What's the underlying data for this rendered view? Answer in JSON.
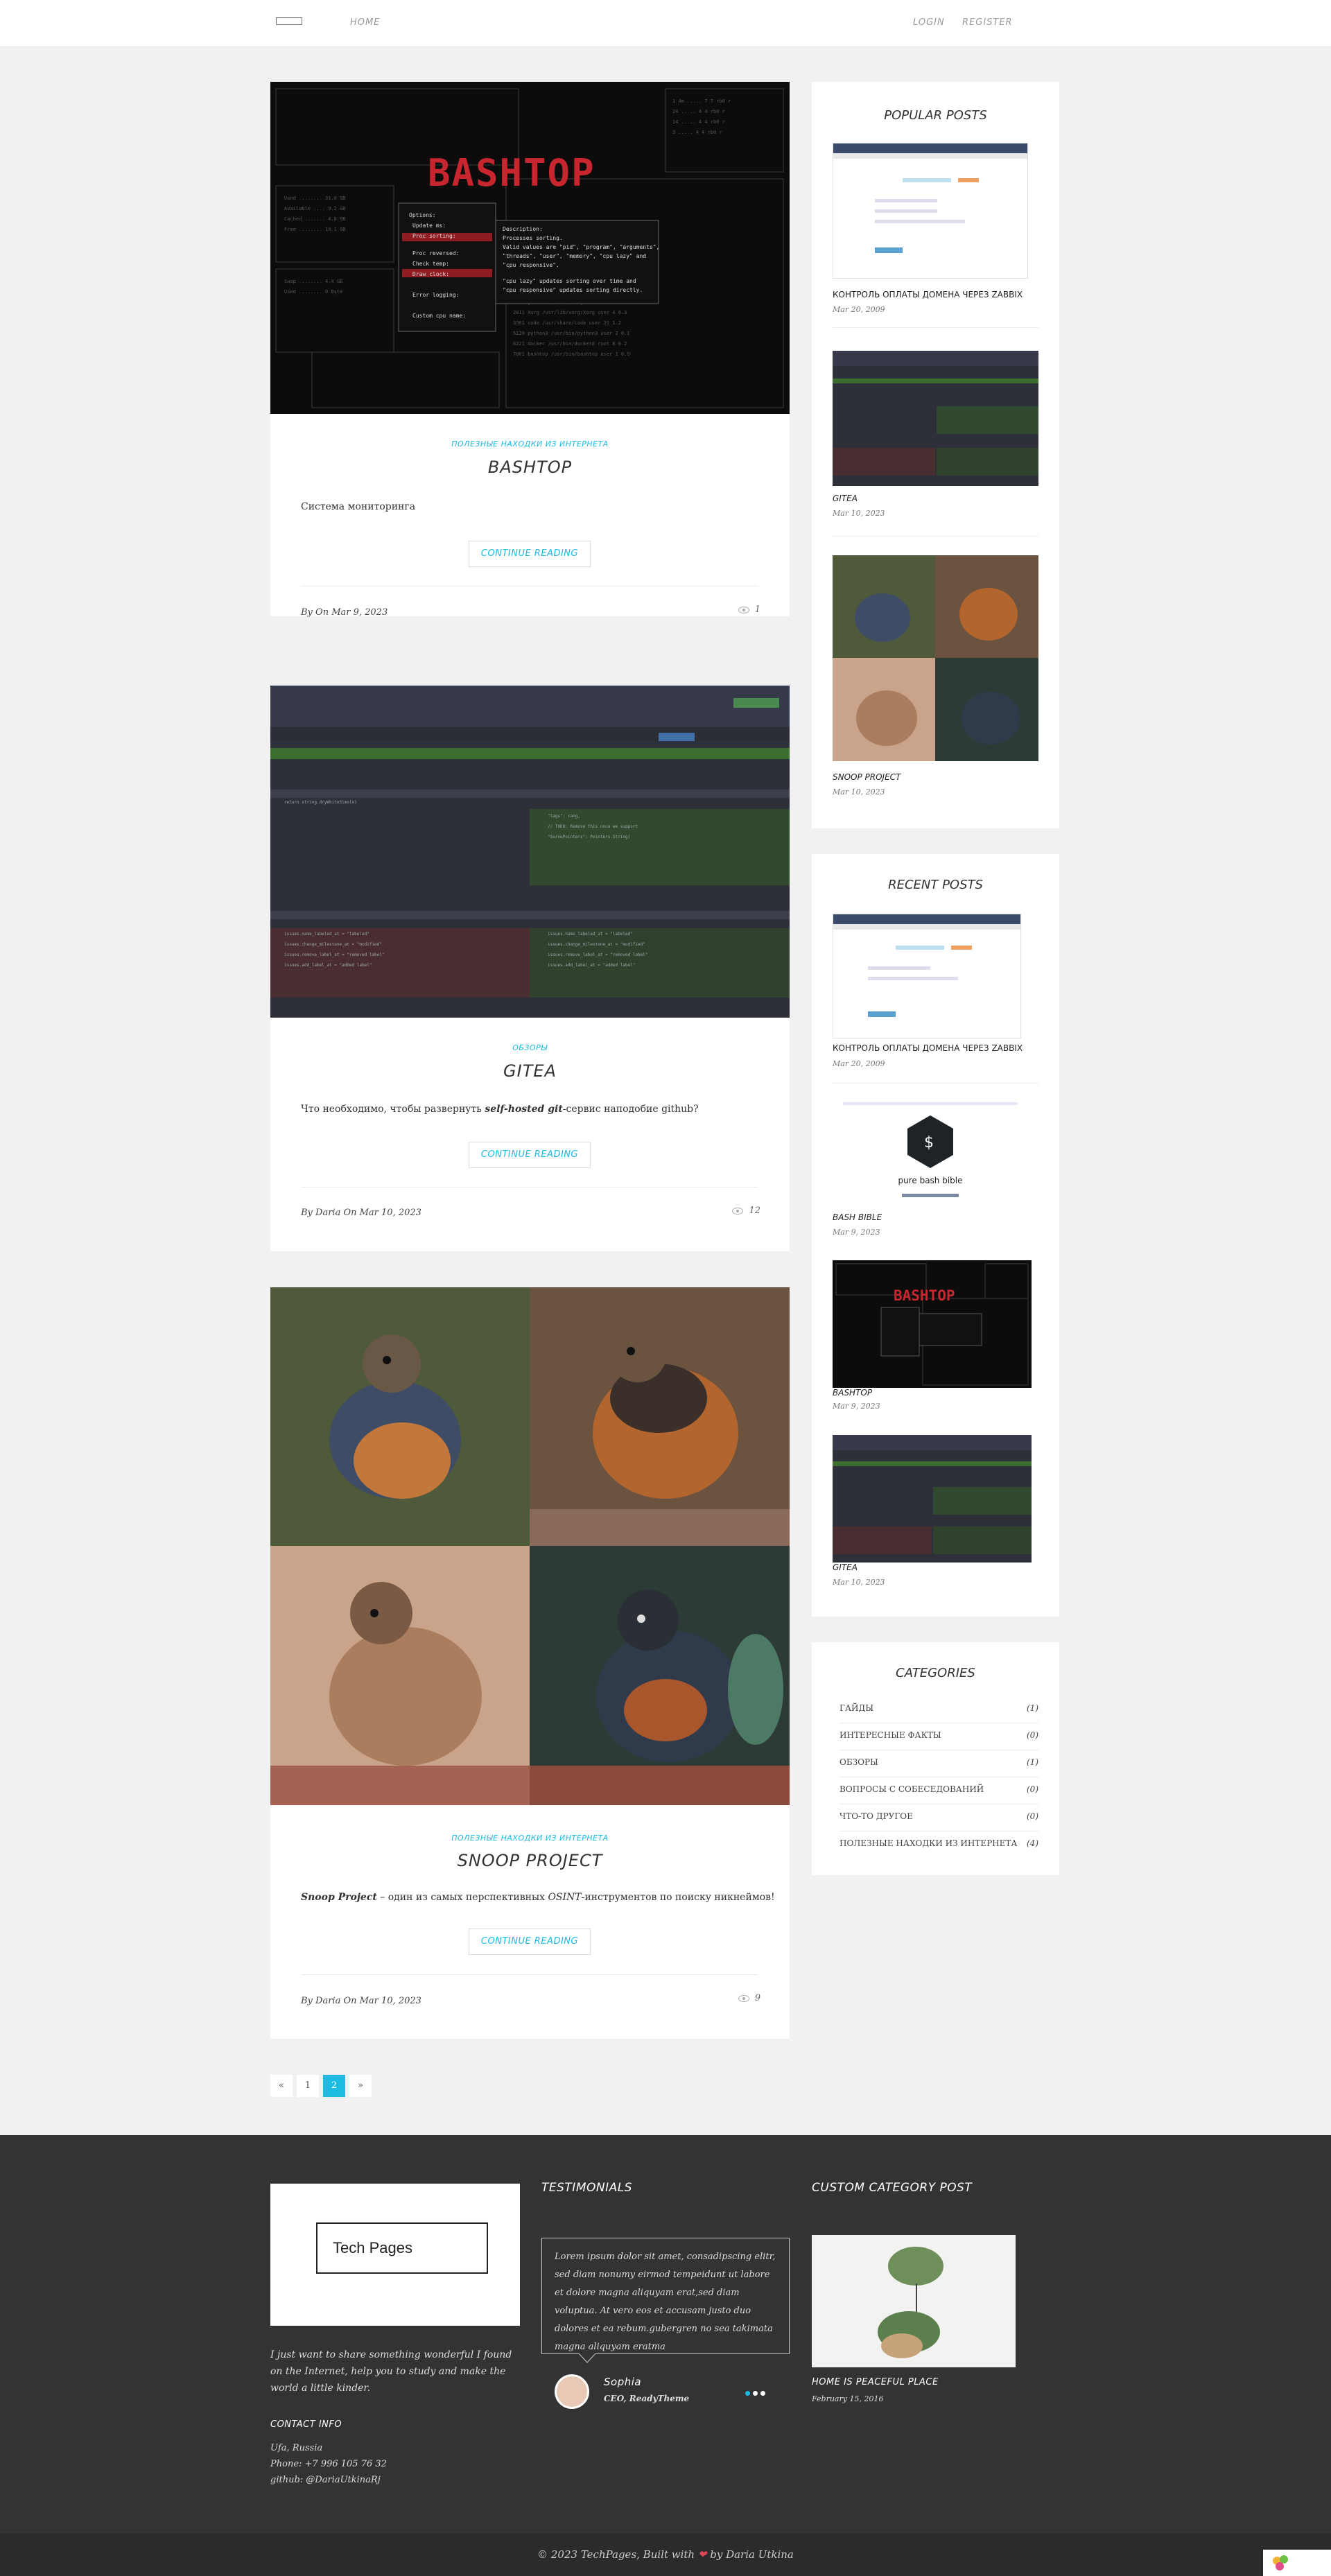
{
  "nav": {
    "home": "HOME",
    "login": "LOGIN",
    "register": "REGISTER"
  },
  "posts": [
    {
      "category": "ПОЛЕЗНЫЕ НАХОДКИ ИЗ ИНТЕРНЕТА",
      "title": "BASHTOP",
      "excerpt": "Система мониторинга",
      "continue": "CONTINUE READING",
      "meta": "By On Mar 9, 2023",
      "views": "1"
    },
    {
      "category": "ОБЗОРЫ",
      "title": "GITEA",
      "excerpt_pre": "Что необходимо, чтобы развернуть ",
      "excerpt_em": "self-hosted git",
      "excerpt_post": "-сервис наподобие github?",
      "continue": "CONTINUE READING",
      "meta": "By Daria On Mar 10, 2023",
      "views": "12"
    },
    {
      "category": "ПОЛЕЗНЫЕ НАХОДКИ ИЗ ИНТЕРНЕТА",
      "title": "SNOOP PROJECT",
      "excerpt_em": "Snoop Project",
      "excerpt_mid": " – один из самых перспективных ",
      "excerpt_em2": "OSINT",
      "excerpt_post": "-инструментов по поиску никнеймов!",
      "continue": "CONTINUE READING",
      "meta": "By Daria On Mar 10, 2023",
      "views": "9"
    }
  ],
  "bashtop_art": "BASHTOP",
  "popular": {
    "title": "POPULAR POSTS",
    "items": [
      {
        "name": "КОНТРОЛЬ ОПЛАТЫ ДОМЕНА ЧЕРЕЗ ZABBIX",
        "date": "Mar 20, 2009"
      },
      {
        "name": "GITEA",
        "date": "Mar 10, 2023"
      },
      {
        "name": "SNOOP PROJECT",
        "date": "Mar 10, 2023"
      }
    ]
  },
  "recent": {
    "title": "RECENT POSTS",
    "items": [
      {
        "name": "КОНТРОЛЬ ОПЛАТЫ ДОМЕНА ЧЕРЕЗ ZABBIX",
        "date": "Mar 20, 2009"
      },
      {
        "name": "BASH BIBLE",
        "date": "Mar 9, 2023"
      },
      {
        "name": "BASHTOP",
        "date": "Mar 9, 2023"
      },
      {
        "name": "GITEA",
        "date": "Mar 10, 2023"
      }
    ],
    "bash_bible_label": "pure bash bible"
  },
  "categories": {
    "title": "CATEGORIES",
    "items": [
      {
        "name": "ГАЙДЫ",
        "count": "(1)"
      },
      {
        "name": "ИНТЕРЕСНЫЕ ФАКТЫ",
        "count": "(0)"
      },
      {
        "name": "ОБЗОРЫ",
        "count": "(1)"
      },
      {
        "name": "ВОПРОСЫ С СОБЕСЕДОВАНИЙ",
        "count": "(0)"
      },
      {
        "name": "ЧТО-ТО ДРУГОЕ",
        "count": "(0)"
      },
      {
        "name": "ПОЛЕЗНЫЕ НАХОДКИ ИЗ ИНТЕРНЕТА",
        "count": "(4)"
      }
    ]
  },
  "pagination": [
    "«",
    "1",
    "2",
    "»"
  ],
  "footer": {
    "logo": "Tech Pages",
    "about": "I just want to share something wonderful I found on the Internet, help you to study and make the world a little kinder.",
    "contact_title": "CONTACT INFO",
    "contact_city": "Ufa, Russia",
    "contact_phone": "Phone: +7 996 105 76 32",
    "contact_github": "github: @DariaUtkinaRj",
    "testimonials_title": "TESTIMONIALS",
    "testimonial_text": "Lorem ipsum dolor sit amet, consadipscing elitr, sed diam nonumy eirmod tempeidunt ut labore et dolore magna aliquyam erat,sed diam voluptua. At vero eos et accusam justo duo dolores et ea rebum.gubergren no sea takimata magna aliquyam eratma",
    "testimonial_name": "Sophia",
    "testimonial_role": "CEO, ReadyTheme",
    "custom_title": "CUSTOM CATEGORY POST",
    "custom_post_name": "HOME IS PEACEFUL PLACE",
    "custom_post_date": "February 15, 2016",
    "copyright_pre": "© 2023 TechPages, Built with",
    "copyright_post": "by Daria Utkina"
  },
  "colors": {
    "accent": "#1bbbe2",
    "heart": "#e0465b",
    "footer_bg": "#333333"
  }
}
